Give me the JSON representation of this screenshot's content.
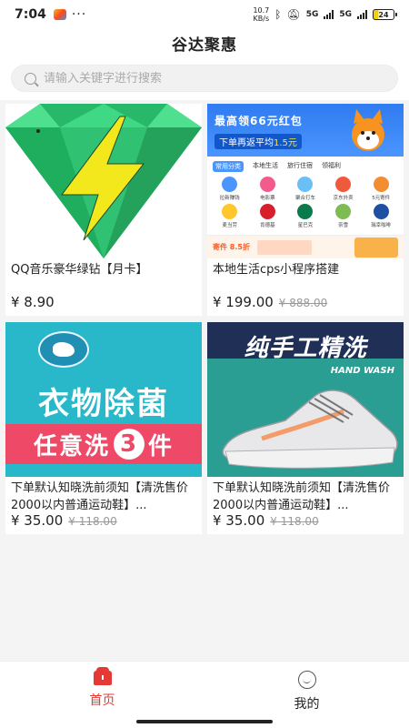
{
  "status_bar": {
    "time": "7:04",
    "more": "···",
    "net_speed_value": "10.7",
    "net_speed_unit": "KB/s",
    "signal_1": "5G",
    "signal_2": "5G",
    "battery": "24"
  },
  "header": {
    "title": "谷达聚惠"
  },
  "search": {
    "placeholder": "请输入关键字进行搜索",
    "value": ""
  },
  "products": [
    {
      "name": "QQ音乐豪华绿钻【月卡】",
      "price": "¥ 8.90",
      "original_price": ""
    },
    {
      "name": "本地生活cps小程序搭建",
      "price": "¥ 199.00",
      "original_price": "¥ 888.00"
    },
    {
      "name": "下单默认知晓洗前须知【清洗售价2000以内普通运动鞋】...",
      "price": "¥ 35.00",
      "original_price": "¥ 118.00"
    },
    {
      "name": "下单默认知晓洗前须知【清洗售价2000以内普通运动鞋】...",
      "price": "¥ 35.00",
      "original_price": "¥ 118.00"
    }
  ],
  "thumb_mini_program": {
    "headline": "最高领66元红包",
    "subline_prefix": "下单再返平均",
    "subline_amount": "1.5元",
    "tabs": [
      "常用分类",
      "本地生活",
      "旅行住宿",
      "领福利"
    ],
    "icons": [
      {
        "label": "拉新赚钱",
        "color": "#4b95ff"
      },
      {
        "label": "电影票",
        "color": "#f45b8d"
      },
      {
        "label": "聚合打车",
        "color": "#6ac0f5"
      },
      {
        "label": "京东外卖",
        "color": "#f05a3c"
      },
      {
        "label": "5元寄件",
        "color": "#f28d32"
      },
      {
        "label": "麦当劳",
        "color": "#ffc72c"
      },
      {
        "label": "肯德基",
        "color": "#d6202b"
      },
      {
        "label": "星巴克",
        "color": "#0b7a4b"
      },
      {
        "label": "奈雪",
        "color": "#7dbb53"
      },
      {
        "label": "瑞幸咖啡",
        "color": "#1f4fa3"
      }
    ],
    "bottom_text": "寄件 8.5折"
  },
  "thumb_laundry": {
    "line1": "衣物除菌",
    "line2_prefix": "任意洗",
    "line2_num": "3",
    "line2_suffix": "件"
  },
  "thumb_shoe": {
    "slogan": "纯手工精洗",
    "tag": "HAND WASH"
  },
  "bottom_nav": [
    {
      "label": "首页",
      "icon": "home-icon",
      "active": true
    },
    {
      "label": "我的",
      "icon": "smiley-icon",
      "active": false
    }
  ],
  "colors": {
    "accent": "#e53935",
    "price": "#222222",
    "page_bg": "#f4f4f4"
  }
}
